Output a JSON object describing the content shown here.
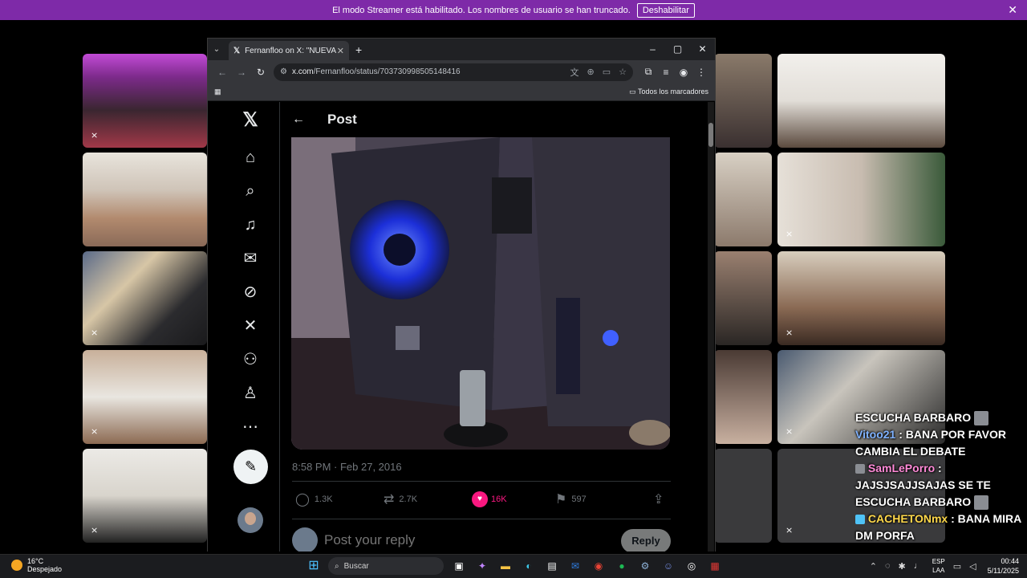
{
  "banner": {
    "message": "El modo Streamer está habilitado. Los nombres de usuario se han truncado.",
    "button": "Deshabilitar",
    "close": "✕"
  },
  "browser": {
    "tab_title": "Fernanfloo on X: \"NUEVA PC 😢",
    "url_domain": "x.com",
    "url_path": "/Fernanfloo/status/703730998505148416",
    "bookmarks_label": "Todos los marcadores"
  },
  "x": {
    "header_title": "Post",
    "timestamp": "8:58 PM · Feb 27, 2016",
    "replies": "1.3K",
    "reposts": "2.7K",
    "likes": "16K",
    "bookmarks": "597",
    "reply_placeholder": "Post your reply",
    "reply_button": "Reply"
  },
  "chat": {
    "line1": "ESCUCHA BARBARO",
    "msg2_user": "Vitoo21",
    "msg2_text": " : BANA POR FAVOR CAMBIA EL DEBATE",
    "msg3_user": "SamLePorro",
    "msg3_text": " : JAJSJSAJJSAJAS SE TE ESCUCHA BARBARO",
    "msg4_user": "CACHETONmx",
    "msg4_text": " : BANA MIRA DM PORFA"
  },
  "taskbar": {
    "temp": "16°C",
    "weather": "Despejado",
    "search": "Buscar",
    "lang1": "ESP",
    "lang2": "LAA",
    "time": "00:44",
    "date": "5/11/2025"
  },
  "colors": {
    "banner": "#7e2aa8",
    "like": "#f91880"
  }
}
